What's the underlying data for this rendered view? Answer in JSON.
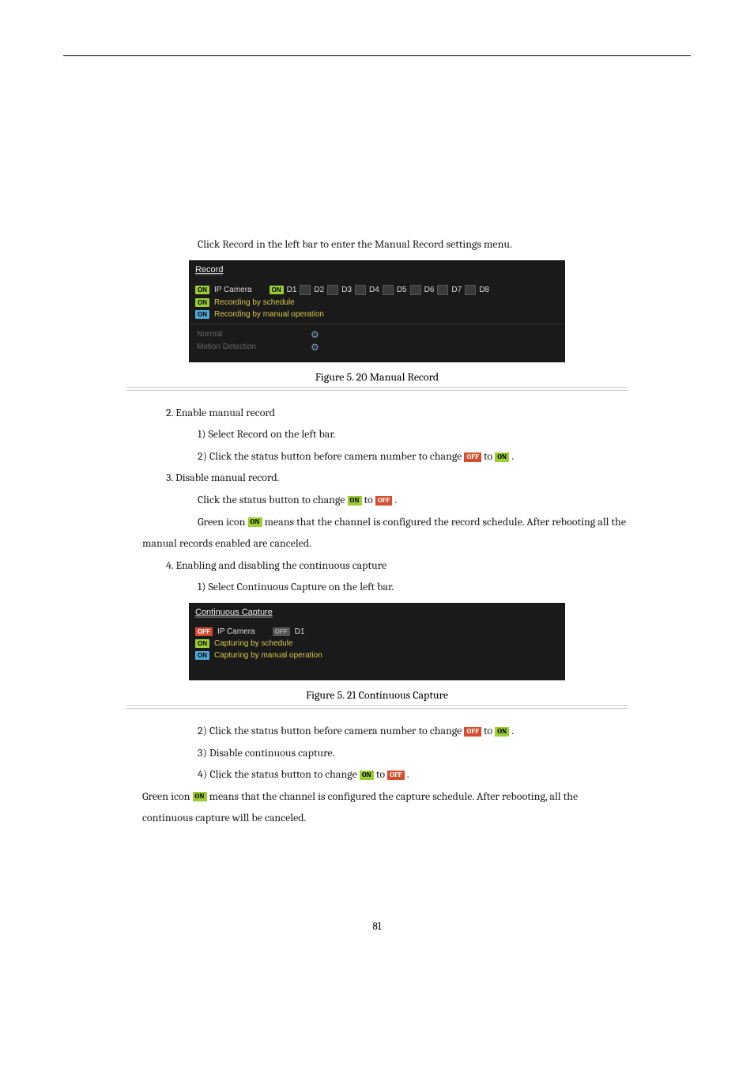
{
  "page_number": "81",
  "intro_text": "Click Record in the left bar to enter the Manual Record settings menu.",
  "screenshot1": {
    "title": "Record",
    "ipcamera_label": "IP Camera",
    "cameras": [
      "D1",
      "D2",
      "D3",
      "D4",
      "D5",
      "D6",
      "D7",
      "D8"
    ],
    "legend_schedule": "Recording by schedule",
    "legend_manual": "Recording by manual operation",
    "mode_normal": "Normal",
    "mode_motion": "Motion Detection"
  },
  "caption1": "Figure 5. 20 Manual Record",
  "step2_line1": "2. Enable manual record",
  "step2_sub1": "1) Select Record on the left bar.",
  "step2_sub2_a": "2) Click the status button before camera number to change ",
  "step2_sub2_b": " to ",
  "step2_sub2_c": ".",
  "step3_line1": "3. Disable manual record.",
  "step3_sub1_a": "Click the status button to change ",
  "step3_sub1_b": " to ",
  "step3_sub1_c": ".",
  "note1_a": "Green icon ",
  "note1_b": " means that the channel is configured the record schedule. After rebooting all the",
  "note1_c": "manual records enabled are canceled.",
  "step4_line1": "4. Enabling and disabling the continuous capture",
  "step4_sub1": "1) Select Continuous Capture on the left bar.",
  "screenshot2": {
    "title": "Continuous Capture",
    "ipcamera_label": "IP Camera",
    "camera": "D1",
    "legend_schedule": "Capturing by schedule",
    "legend_manual": "Capturing by manual operation"
  },
  "caption2": "Figure 5. 21 Continuous Capture",
  "step4_sub2_a": "2) Click the status button before camera number to change ",
  "step4_sub2_b": " to ",
  "step4_sub2_c": ".",
  "step4_sub3_a": "3) Disable continuous capture.",
  "step4_sub4_a": "4) Click the status button to change ",
  "step4_sub4_b": " to ",
  "step4_sub4_c": ".",
  "note2_a": "Green icon ",
  "note2_b": " means that the channel is configured the capture schedule. After rebooting, all the",
  "note2_c": "continuous capture will be canceled.",
  "badge_on": "ON",
  "badge_off": "OFF"
}
